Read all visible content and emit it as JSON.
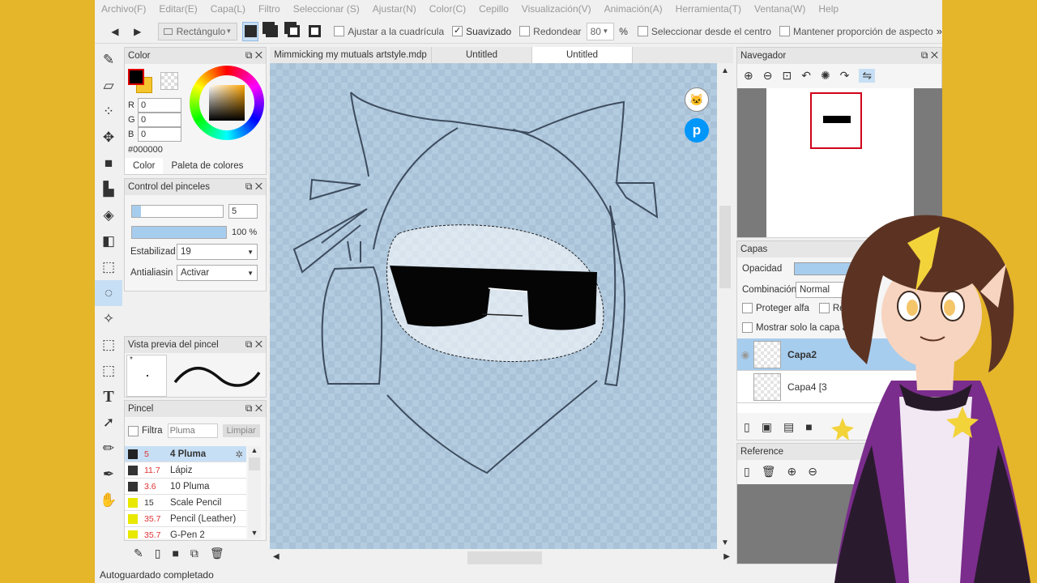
{
  "menu": [
    "Archivo(F)",
    "Editar(E)",
    "Capa(L)",
    "Filtro",
    "Seleccionar (S)",
    "Ajustar(N)",
    "Color(C)",
    "Cepillo",
    "Visualización(V)",
    "Animación(A)",
    "Herramienta(T)",
    "Ventana(W)",
    "Help"
  ],
  "toolbar": {
    "prev_label": "◀",
    "next_label": "▶",
    "shape_select": "Rectángulo",
    "snap_grid": "Ajustar a la cuadrícula",
    "smoothing": "Suavizado",
    "round": "Redondear",
    "round_value": "80",
    "percent": "%",
    "select_center": "Seleccionar desde el centro",
    "keep_ratio": "Mantener proporción de aspecto",
    "more": "»"
  },
  "color_panel": {
    "title": "Color",
    "r_label": "R",
    "r_value": "0",
    "g_label": "G",
    "g_value": "0",
    "b_label": "B",
    "b_value": "0",
    "hex": "#000000",
    "tab_color": "Color",
    "tab_palette": "Paleta de colores"
  },
  "brush_control": {
    "title": "Control del pinceles",
    "size_value": "5",
    "opacity_value": "100 %",
    "stabilizer_label": "Estabilizad",
    "stabilizer_value": "19",
    "antialias_label": "Antialiasin",
    "antialias_value": "Activar"
  },
  "brush_preview": {
    "title": "Vista previa del pincel",
    "marker": "*"
  },
  "brush_panel": {
    "title": "Pincel",
    "filter_label": "Filtra",
    "filter_placeholder": "Pluma",
    "clear_label": "Limpiar",
    "items": [
      {
        "size": "5",
        "name": "4 Pluma",
        "color": "#222222",
        "active": true
      },
      {
        "size": "11.7",
        "name": "Lápiz",
        "color": "#333333"
      },
      {
        "size": "3.6",
        "name": "10 Pluma",
        "color": "#333333"
      },
      {
        "size": "15",
        "name": "Scale Pencil",
        "color": "#e8e800"
      },
      {
        "size": "35.7",
        "name": "Pencil (Leather)",
        "color": "#e8e800"
      },
      {
        "size": "35.7",
        "name": "G-Pen 2",
        "color": "#e8e800"
      }
    ]
  },
  "tabs": [
    "Mimmicking my mutuals artstyle.mdp",
    "Untitled",
    "Untitled"
  ],
  "navigator": {
    "title": "Navegador"
  },
  "layers": {
    "title": "Capas",
    "opacity_label": "Opacidad",
    "blend_label": "Combinación",
    "blend_value": "Normal",
    "protect_alpha": "Proteger alfa",
    "clip_partial": "Re",
    "show_only": "Mostrar solo la capa activa",
    "items": [
      {
        "name": "Capa2",
        "active": true
      },
      {
        "name": "Capa4 [3"
      }
    ]
  },
  "reference": {
    "title": "Reference"
  },
  "status": "Autoguardado completado",
  "colors": {
    "accent": "#c7dff5",
    "canvas_bg": "#b4cce0",
    "frame": "#e5b52a",
    "foreground": "#000000",
    "background": "#f5c530"
  }
}
